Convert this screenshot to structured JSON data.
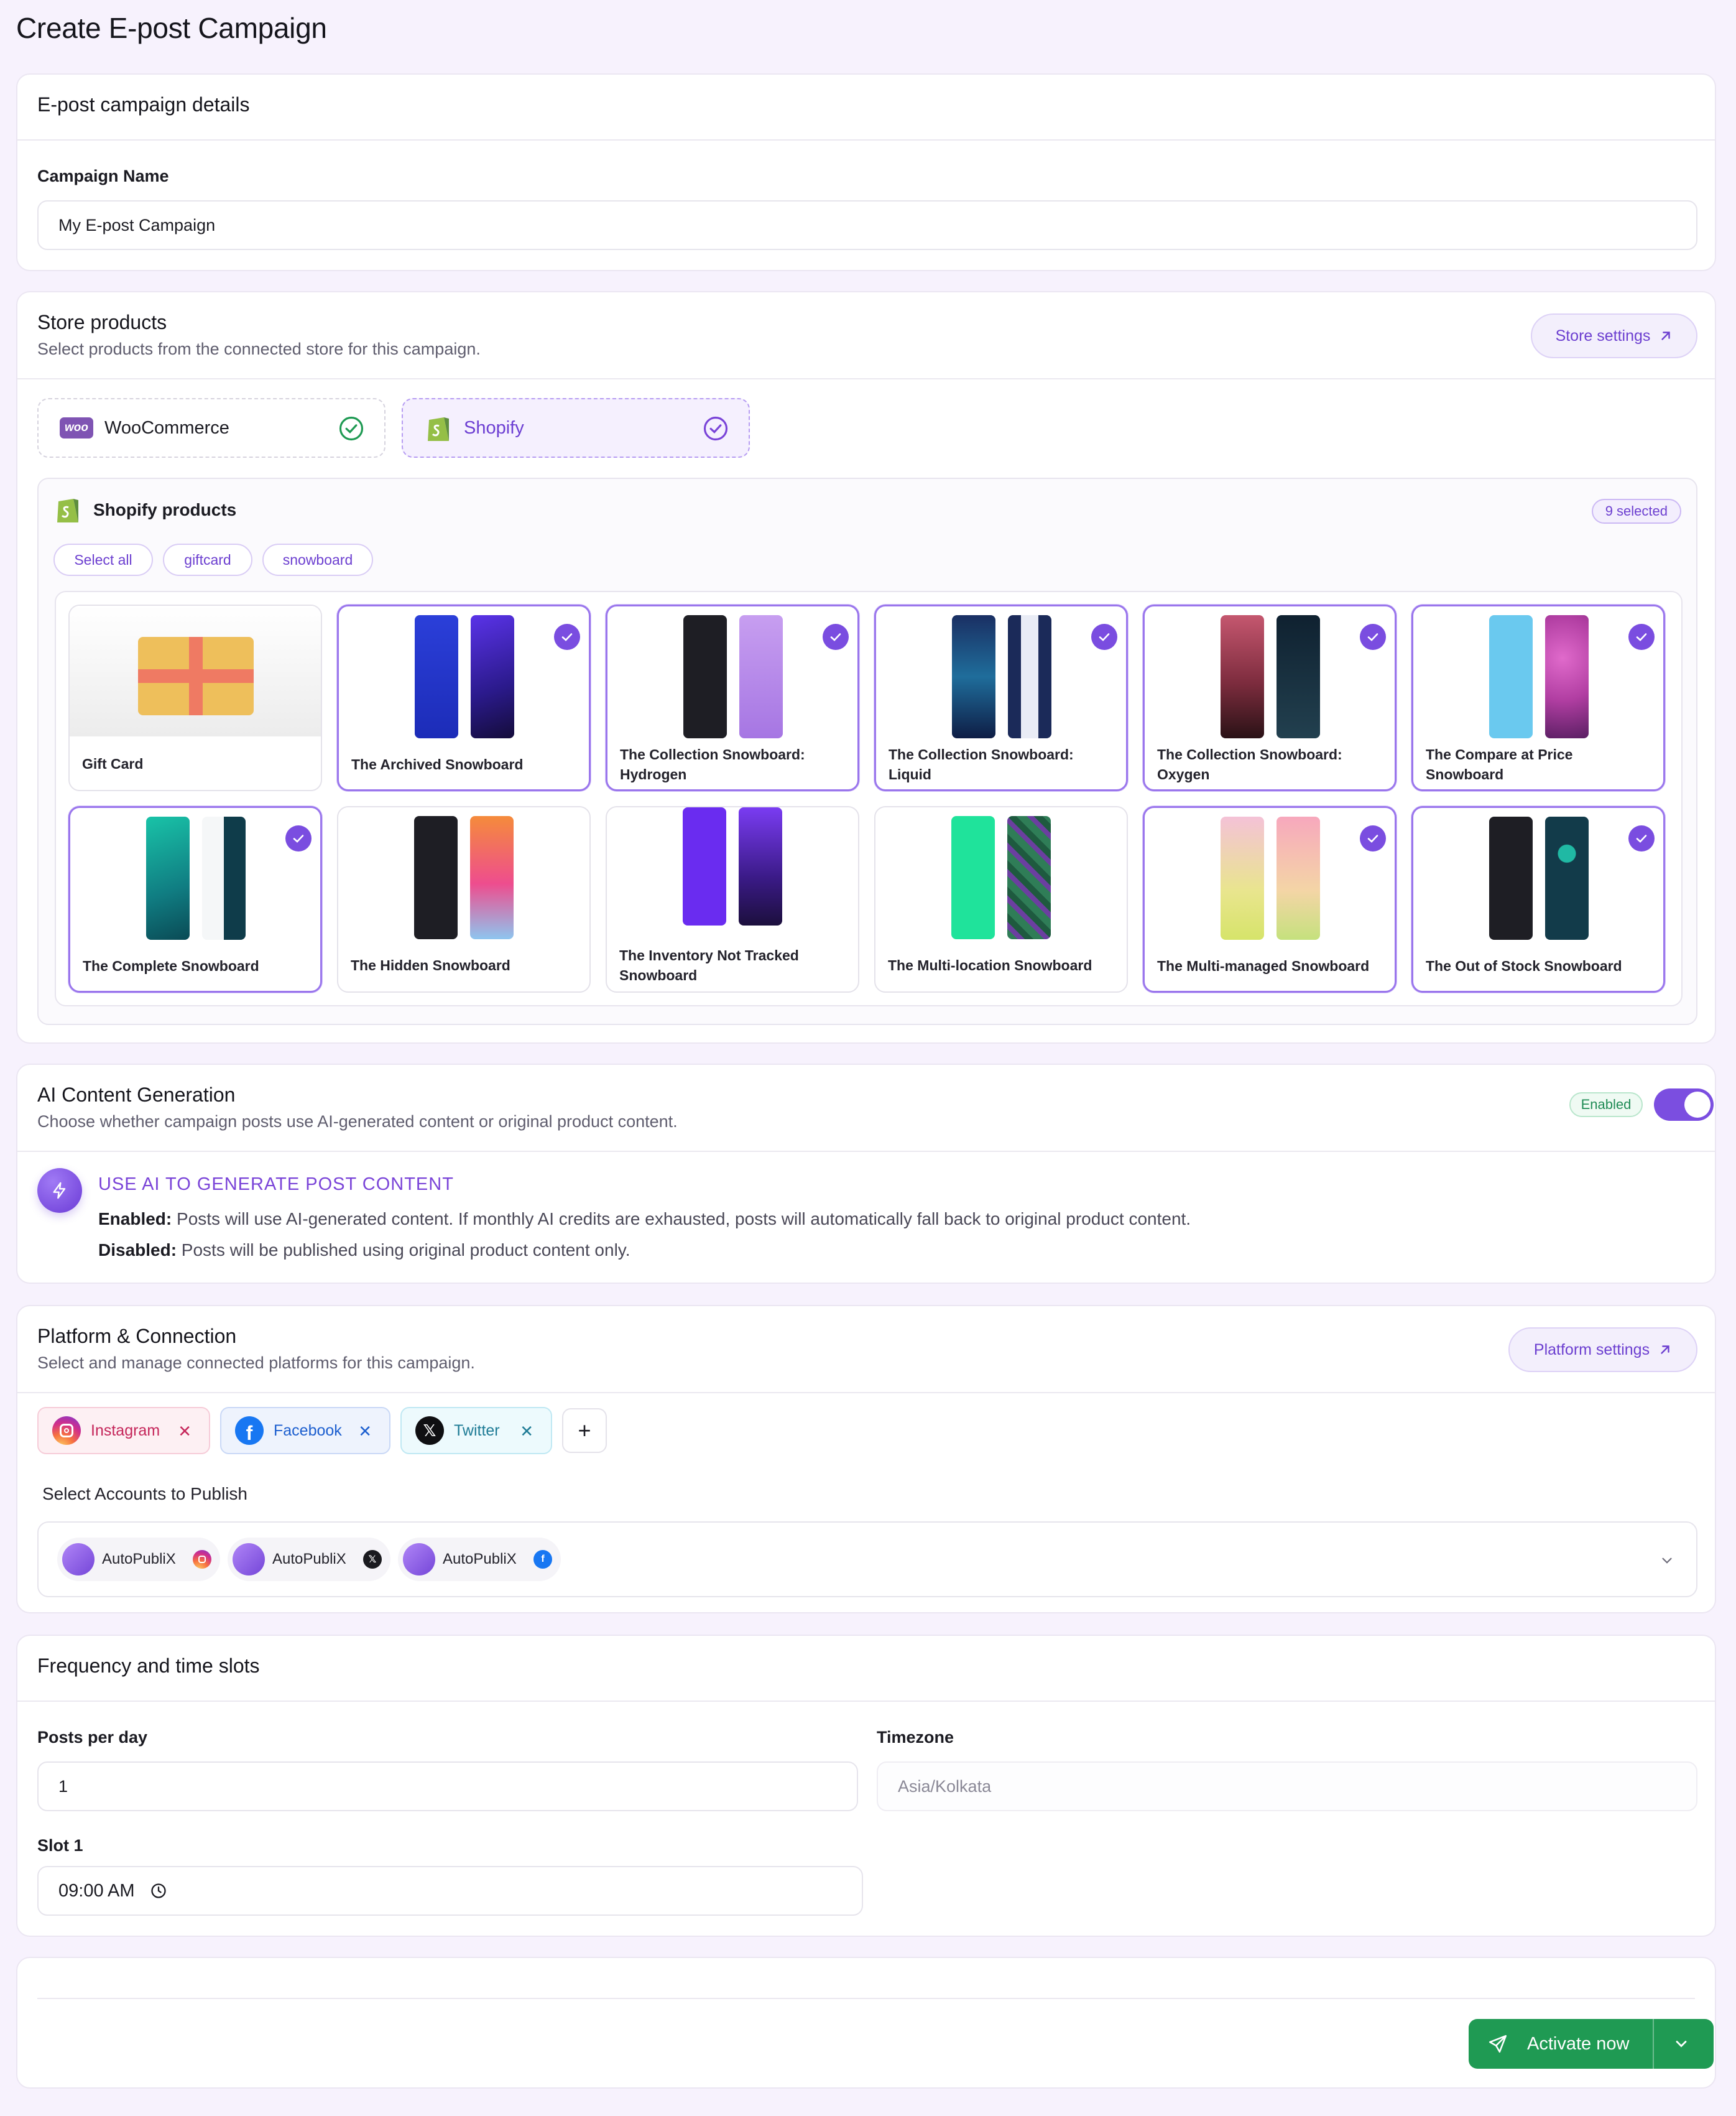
{
  "page": {
    "title": "Create E-post Campaign"
  },
  "details": {
    "title": "E-post campaign details",
    "name_label": "Campaign Name",
    "name_value": "My E-post Campaign"
  },
  "store": {
    "title": "Store products",
    "subtitle": "Select products from the connected store for this campaign.",
    "settings_button": "Store settings",
    "tabs": [
      {
        "label": "WooCommerce",
        "logo_text": "woo",
        "icon": "check-circle-icon"
      },
      {
        "label": "Shopify",
        "icon": "check-circle-icon"
      }
    ],
    "panel_title": "Shopify products",
    "selected_badge": "9 selected",
    "chips": [
      "Select all",
      "giftcard",
      "snowboard"
    ],
    "products": [
      {
        "label": "Gift Card",
        "selected": false
      },
      {
        "label": "The Archived Snowboard",
        "selected": true
      },
      {
        "label": "The Collection Snowboard: Hydrogen",
        "selected": true
      },
      {
        "label": "The Collection Snowboard: Liquid",
        "selected": true
      },
      {
        "label": "The Collection Snowboard: Oxygen",
        "selected": true
      },
      {
        "label": "The Compare at Price Snowboard",
        "selected": true
      },
      {
        "label": "The Complete Snowboard",
        "selected": true
      },
      {
        "label": "The Hidden Snowboard",
        "selected": false
      },
      {
        "label": "The Inventory Not Tracked Snowboard",
        "selected": false
      },
      {
        "label": "The Multi-location Snowboard",
        "selected": false
      },
      {
        "label": "The Multi-managed Snowboard",
        "selected": true
      },
      {
        "label": "The Out of Stock Snowboard",
        "selected": true
      }
    ]
  },
  "ai": {
    "title": "AI Content Generation",
    "subtitle": "Choose whether campaign posts use AI-generated content or original product content.",
    "badge": "Enabled",
    "toggle_on": true,
    "heading": "USE AI TO GENERATE POST CONTENT",
    "enabled_label": "Enabled:",
    "enabled_text": " Posts will use AI-generated content. If monthly AI credits are exhausted, posts will automatically fall back to original product content.",
    "disabled_label": "Disabled:",
    "disabled_text": " Posts will be published using original product content only."
  },
  "platform": {
    "title": "Platform & Connection",
    "subtitle": "Select and manage connected platforms for this campaign.",
    "settings_button": "Platform settings",
    "chips": [
      {
        "label": "Instagram",
        "icon": "instagram-icon"
      },
      {
        "label": "Facebook",
        "icon": "facebook-icon"
      },
      {
        "label": "Twitter",
        "icon": "x-icon"
      }
    ],
    "add_label": "+",
    "accounts_label": "Select Accounts to Publish",
    "accounts": [
      {
        "name": "AutoPubliX",
        "platform_icon": "instagram-icon"
      },
      {
        "name": "AutoPubliX",
        "platform_icon": "x-icon"
      },
      {
        "name": "AutoPubliX",
        "platform_icon": "facebook-icon"
      }
    ]
  },
  "frequency": {
    "title": "Frequency and time slots",
    "posts_label": "Posts per day",
    "posts_value": "1",
    "timezone_label": "Timezone",
    "timezone_placeholder": "Asia/Kolkata",
    "slot_label": "Slot 1",
    "slot_value": "09:00 AM"
  },
  "footer": {
    "activate_label": "Activate now"
  },
  "colors": {
    "accent": "#7b4ee0",
    "success": "#1f9a53",
    "background": "#f7f2fd"
  }
}
